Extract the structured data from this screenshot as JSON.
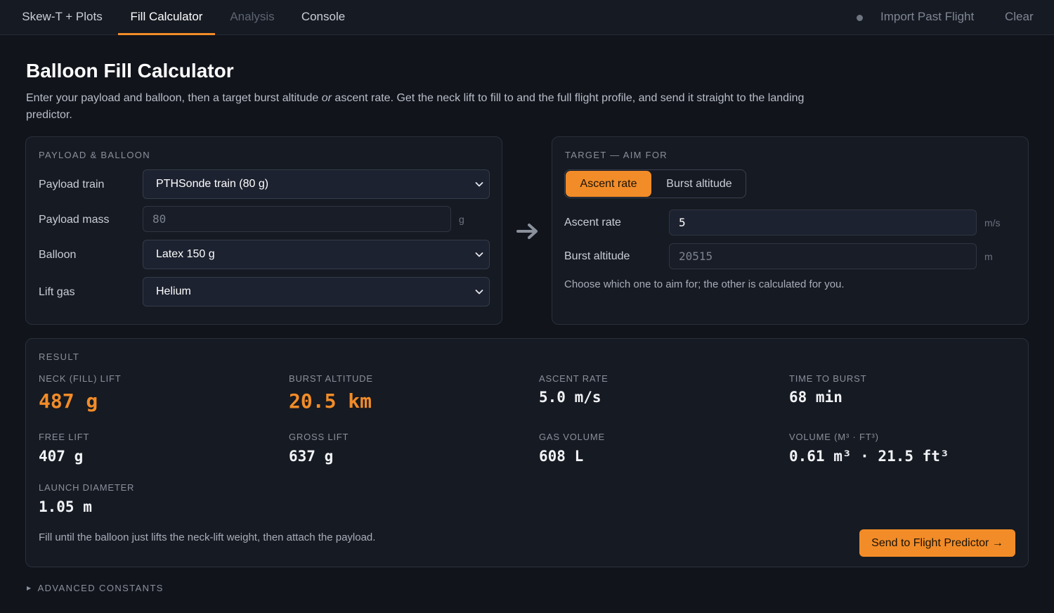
{
  "tabs": [
    {
      "label": "Skew-T + Plots",
      "state": "normal"
    },
    {
      "label": "Fill Calculator",
      "state": "active"
    },
    {
      "label": "Analysis",
      "state": "disabled"
    },
    {
      "label": "Console",
      "state": "normal"
    }
  ],
  "header_actions": {
    "import_label": "Import Past Flight",
    "clear_label": "Clear"
  },
  "page": {
    "title": "Balloon Fill Calculator",
    "desc_part1": "Enter your payload and balloon, then a target burst altitude ",
    "desc_em": "or",
    "desc_part2": " ascent rate. Get the neck lift to fill to and the full flight profile, and send it straight to the landing predictor."
  },
  "payload_card": {
    "title": "Payload & Balloon",
    "payload_train_label": "Payload train",
    "payload_train_value": "PTHSonde train (80 g)",
    "payload_mass_label": "Payload mass",
    "payload_mass_value": "80",
    "payload_mass_unit": "g",
    "balloon_label": "Balloon",
    "balloon_value": "Latex 150 g",
    "lift_gas_label": "Lift gas",
    "lift_gas_value": "Helium"
  },
  "target_card": {
    "title": "Target — aim for",
    "toggle_ascent": "Ascent rate",
    "toggle_burst": "Burst altitude",
    "selected": "Ascent rate",
    "ascent_label": "Ascent rate",
    "ascent_value": "5",
    "ascent_unit": "m/s",
    "burst_label": "Burst altitude",
    "burst_value": "20515",
    "burst_unit": "m",
    "hint": "Choose which one to aim for; the other is calculated for you."
  },
  "result": {
    "title": "Result",
    "neck_lift_label": "Neck (fill) lift",
    "neck_lift_value": "487 g",
    "burst_altitude_label": "Burst altitude",
    "burst_altitude_value": "20.5 km",
    "ascent_rate_label": "Ascent rate",
    "ascent_rate_value": "5.0 m/s",
    "time_to_burst_label": "Time to burst",
    "time_to_burst_value": "68 min",
    "free_lift_label": "Free lift",
    "free_lift_value": "407 g",
    "gross_lift_label": "Gross lift",
    "gross_lift_value": "637 g",
    "gas_volume_label": "Gas volume",
    "gas_volume_value": "608 L",
    "volume_label": "Volume (m³ · ft³)",
    "volume_value": "0.61 m³ · 21.5 ft³",
    "launch_diameter_label": "Launch diameter",
    "launch_diameter_value": "1.05 m",
    "note": "Fill until the balloon just lifts the neck-lift weight, then attach the payload.",
    "send_label": "Send to Flight Predictor →"
  },
  "advanced_label": "Advanced constants",
  "colors": {
    "accent": "#f28c28",
    "background": "#11141b",
    "card": "#161a22"
  }
}
